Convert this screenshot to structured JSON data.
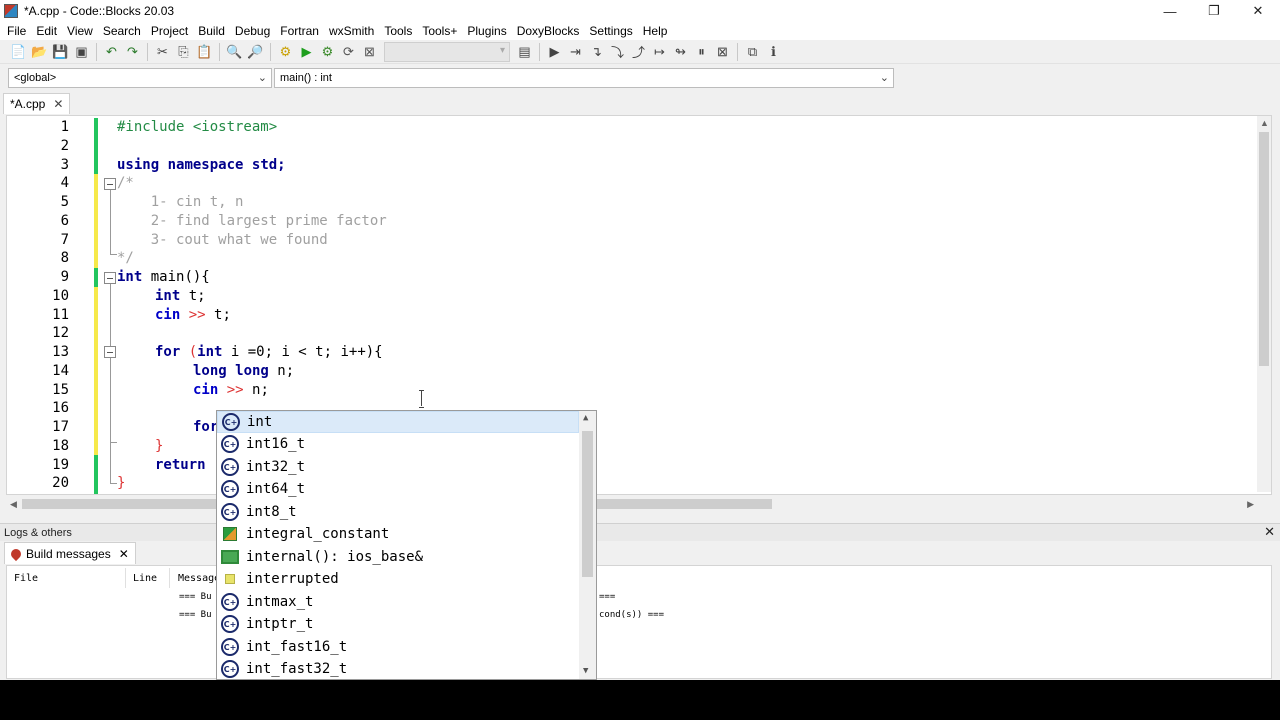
{
  "window": {
    "title": "*A.cpp - Code::Blocks 20.03"
  },
  "menu": [
    "File",
    "Edit",
    "View",
    "Search",
    "Project",
    "Build",
    "Debug",
    "Fortran",
    "wxSmith",
    "Tools",
    "Tools+",
    "Plugins",
    "DoxyBlocks",
    "Settings",
    "Help"
  ],
  "toolbar": {
    "icons": [
      "new-file-icon",
      "open-icon",
      "save-icon",
      "save-all-icon",
      "undo-icon",
      "redo-icon",
      "cut-icon",
      "copy-icon",
      "paste-icon",
      "find-icon",
      "replace-icon",
      "build-icon",
      "run-icon",
      "build-run-icon",
      "rebuild-icon",
      "abort-icon"
    ],
    "debug_icons": [
      "debug-icon",
      "run-to-cursor-icon",
      "next-line-icon",
      "step-into-icon",
      "step-out-icon",
      "next-instruction-icon",
      "step-into-instruction-icon",
      "break-icon",
      "stop-debugger-icon",
      "debug-windows-icon",
      "info-icon"
    ]
  },
  "scope": {
    "global": "<global>",
    "function": "main() : int"
  },
  "editor": {
    "tab_label": "*A.cpp",
    "line_numbers": [
      "1",
      "2",
      "3",
      "4",
      "5",
      "6",
      "7",
      "8",
      "9",
      "10",
      "11",
      "12",
      "13",
      "14",
      "15",
      "16",
      "17",
      "18",
      "19",
      "20"
    ],
    "code": {
      "l1_include": "#include <iostream>",
      "l3_using": "using",
      "l3_namespace": "namespace",
      "l3_std": "std;",
      "l4": "/*",
      "l5": "    1- cin t, n",
      "l6": "    2- find largest prime factor",
      "l7": "    3- cout what we found",
      "l8": "*/",
      "l9_kw": "int",
      "l9_rest": " main(){",
      "l10_kw": "int",
      "l10_rest": " t;",
      "l11_kw": "cin",
      "l11_op": " >>",
      "l11_rest": " t;",
      "l13_kw": "for",
      "l13_p1": " (",
      "l13_kw2": "int",
      "l13_rest": " i =0; i < t; i++){",
      "l14_kw": "long long",
      "l14_rest": " n;",
      "l15_kw": "cin",
      "l15_op": " >>",
      "l15_rest": " n;",
      "l17_kw": "for",
      "l18": "}",
      "l19_kw": "return",
      "l20": "}"
    }
  },
  "logs": {
    "header": "Logs & others",
    "tab_label": "Build messages",
    "columns": [
      "File",
      "Line",
      "Message"
    ],
    "rows": [
      "=== Bu",
      "=== Bu",
      "===",
      "cond(s)) ==="
    ]
  },
  "autocomplete": {
    "items": [
      {
        "label": "int",
        "kind": "class"
      },
      {
        "label": "int16_t",
        "kind": "class"
      },
      {
        "label": "int32_t",
        "kind": "class"
      },
      {
        "label": "int64_t",
        "kind": "class"
      },
      {
        "label": "int8_t",
        "kind": "class"
      },
      {
        "label": "integral_constant",
        "kind": "struct"
      },
      {
        "label": "internal(): ios_base&",
        "kind": "function"
      },
      {
        "label": "interrupted",
        "kind": "variable"
      },
      {
        "label": "intmax_t",
        "kind": "class"
      },
      {
        "label": "intptr_t",
        "kind": "class"
      },
      {
        "label": "int_fast16_t",
        "kind": "class"
      },
      {
        "label": "int_fast32_t",
        "kind": "class"
      }
    ]
  }
}
